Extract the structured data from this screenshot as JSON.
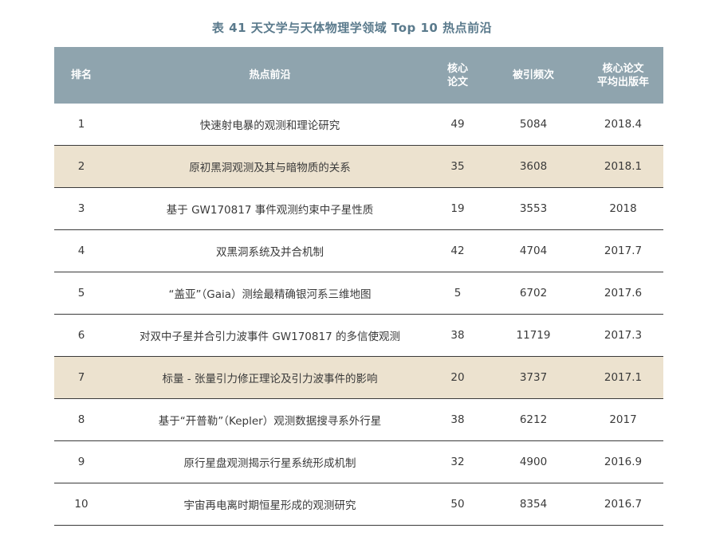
{
  "caption": "表 41   天文学与天体物理学领域 Top 10 热点前沿",
  "columns": {
    "rank": "排名",
    "topic": "热点前沿",
    "core": "核心\n论文",
    "citations": "被引频次",
    "year": "核心论文\n平均出版年"
  },
  "colors": {
    "header_bg": "#8fa4ae",
    "highlight_row": "#ece2cf",
    "caption": "#5a7a8c"
  },
  "rows": [
    {
      "rank": "1",
      "topic": "快速射电暴的观测和理论研究",
      "core": "49",
      "citations": "5084",
      "year": "2018.4",
      "highlight": false
    },
    {
      "rank": "2",
      "topic": "原初黑洞观测及其与暗物质的关系",
      "core": "35",
      "citations": "3608",
      "year": "2018.1",
      "highlight": true
    },
    {
      "rank": "3",
      "topic": "基于 GW170817 事件观测约束中子星性质",
      "core": "19",
      "citations": "3553",
      "year": "2018",
      "highlight": false
    },
    {
      "rank": "4",
      "topic": "双黑洞系统及并合机制",
      "core": "42",
      "citations": "4704",
      "year": "2017.7",
      "highlight": false
    },
    {
      "rank": "5",
      "topic": "“盖亚”（Gaia）测绘最精确银河系三维地图",
      "core": "5",
      "citations": "6702",
      "year": "2017.6",
      "highlight": false
    },
    {
      "rank": "6",
      "topic": "对双中子星并合引力波事件 GW170817 的多信使观测",
      "core": "38",
      "citations": "11719",
      "year": "2017.3",
      "highlight": false
    },
    {
      "rank": "7",
      "topic": "标量 - 张量引力修正理论及引力波事件的影响",
      "core": "20",
      "citations": "3737",
      "year": "2017.1",
      "highlight": true
    },
    {
      "rank": "8",
      "topic": "基于“开普勒”（Kepler）观测数据搜寻系外行星",
      "core": "38",
      "citations": "6212",
      "year": "2017",
      "highlight": false
    },
    {
      "rank": "9",
      "topic": "原行星盘观测揭示行星系统形成机制",
      "core": "32",
      "citations": "4900",
      "year": "2016.9",
      "highlight": false
    },
    {
      "rank": "10",
      "topic": "宇宙再电离时期恒星形成的观测研究",
      "core": "50",
      "citations": "8354",
      "year": "2016.7",
      "highlight": false
    }
  ]
}
